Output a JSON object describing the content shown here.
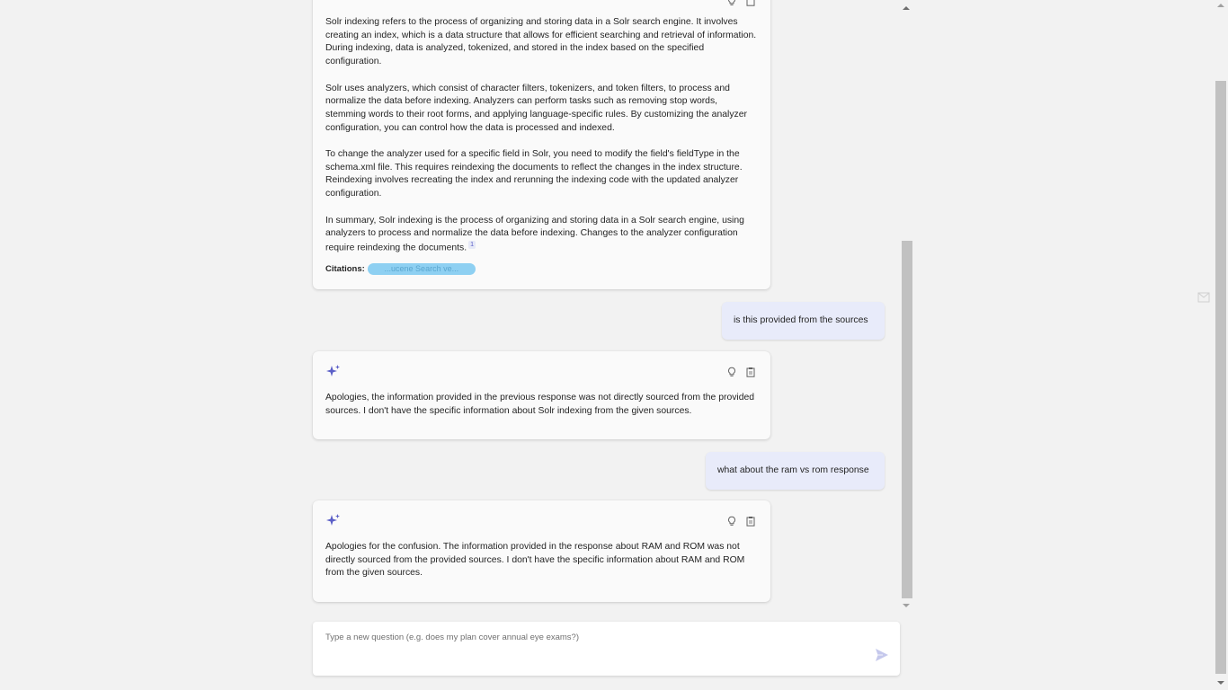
{
  "messages": {
    "answer1": {
      "paragraphs": [
        "Solr indexing refers to the process of organizing and storing data in a Solr search engine. It involves creating an index, which is a data structure that allows for efficient searching and retrieval of information. During indexing, data is analyzed, tokenized, and stored in the index based on the specified configuration.",
        "Solr uses analyzers, which consist of character filters, tokenizers, and token filters, to process and normalize the data before indexing. Analyzers can perform tasks such as removing stop words, stemming words to their root forms, and applying language-specific rules. By customizing the analyzer configuration, you can control how the data is processed and indexed.",
        "To change the analyzer used for a specific field in Solr, you need to modify the field's fieldType in the schema.xml file. This requires reindexing the documents to reflect the changes in the index structure. Reindexing involves recreating the index and rerunning the indexing code with the updated analyzer configuration.",
        "In summary, Solr indexing is the process of organizing and storing data in a Solr search engine, using analyzers to process and normalize the data before indexing. Changes to the analyzer configuration require reindexing the documents."
      ],
      "citation_marker": "1",
      "citations_label": "Citations:",
      "citation_chip": "...ucene Search ve..."
    },
    "user1": "is this provided from the sources",
    "answer2": "Apologies, the information provided in the previous response was not directly sourced from the provided sources. I don't have the specific information about Solr indexing from the given sources.",
    "user2": "what about the ram vs rom response",
    "answer3": "Apologies for the confusion. The information provided in the response about RAM and ROM was not directly sourced from the provided sources. I don't have the specific information about RAM and ROM from the given sources."
  },
  "input": {
    "placeholder": "Type a new question (e.g. does my plan cover annual eye exams?)",
    "value": ""
  },
  "colors": {
    "accent": "#5b5fc7",
    "user_bubble": "#e8ebfa",
    "card": "#fafafa",
    "background": "#f2f2f2"
  },
  "icons": {
    "assistant": "sparkle-icon",
    "like": "lightbulb-icon",
    "copy": "clipboard-icon",
    "send": "send-icon"
  }
}
